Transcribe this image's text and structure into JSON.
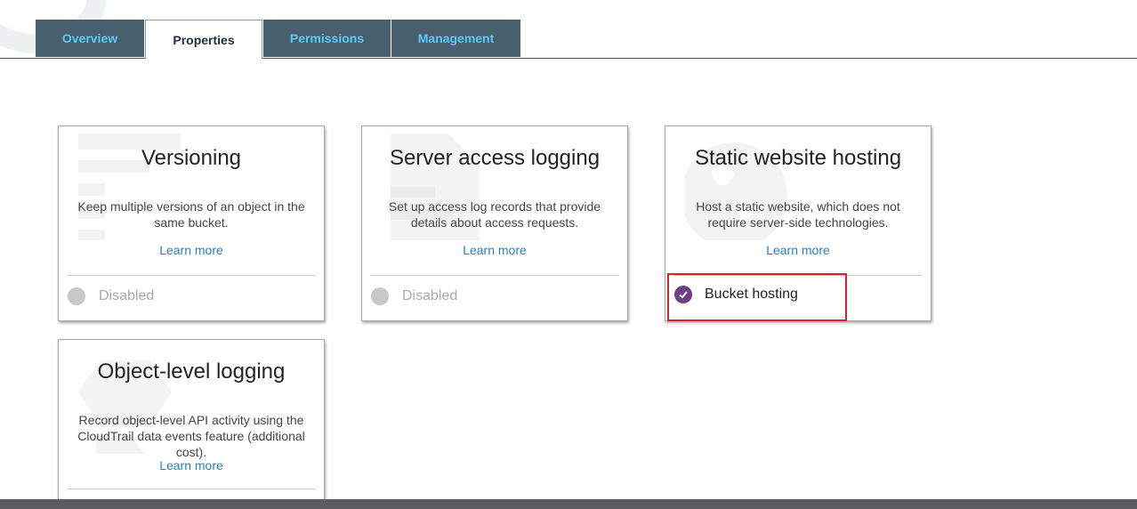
{
  "tabs": [
    {
      "label": "Overview",
      "active": false
    },
    {
      "label": "Properties",
      "active": true
    },
    {
      "label": "Permissions",
      "active": false
    },
    {
      "label": "Management",
      "active": false
    }
  ],
  "cards": {
    "versioning": {
      "title": "Versioning",
      "description": "Keep multiple versions of an object in the same bucket.",
      "learn_more": "Learn more",
      "status": "Disabled"
    },
    "server_access_logging": {
      "title": "Server access logging",
      "description": "Set up access log records that provide details about access requests.",
      "learn_more": "Learn more",
      "status": "Disabled"
    },
    "static_website_hosting": {
      "title": "Static website hosting",
      "description": "Host a static website, which does not require server-side technologies.",
      "learn_more": "Learn more",
      "status": "Bucket hosting"
    },
    "object_level_logging": {
      "title": "Object-level logging",
      "description": "Record object-level API activity using the CloudTrail data events feature (additional cost).",
      "learn_more": "Learn more"
    }
  },
  "colors": {
    "tab_bg": "#485f6e",
    "tab_text": "#5bc8f5",
    "link": "#2a7fc2",
    "enabled_dot": "#6b3f87",
    "disabled_dot": "#c8c8c8",
    "highlight": "#d7232b"
  },
  "icons": {
    "enabled": "checkmark-icon",
    "disabled": "circle-icon"
  }
}
